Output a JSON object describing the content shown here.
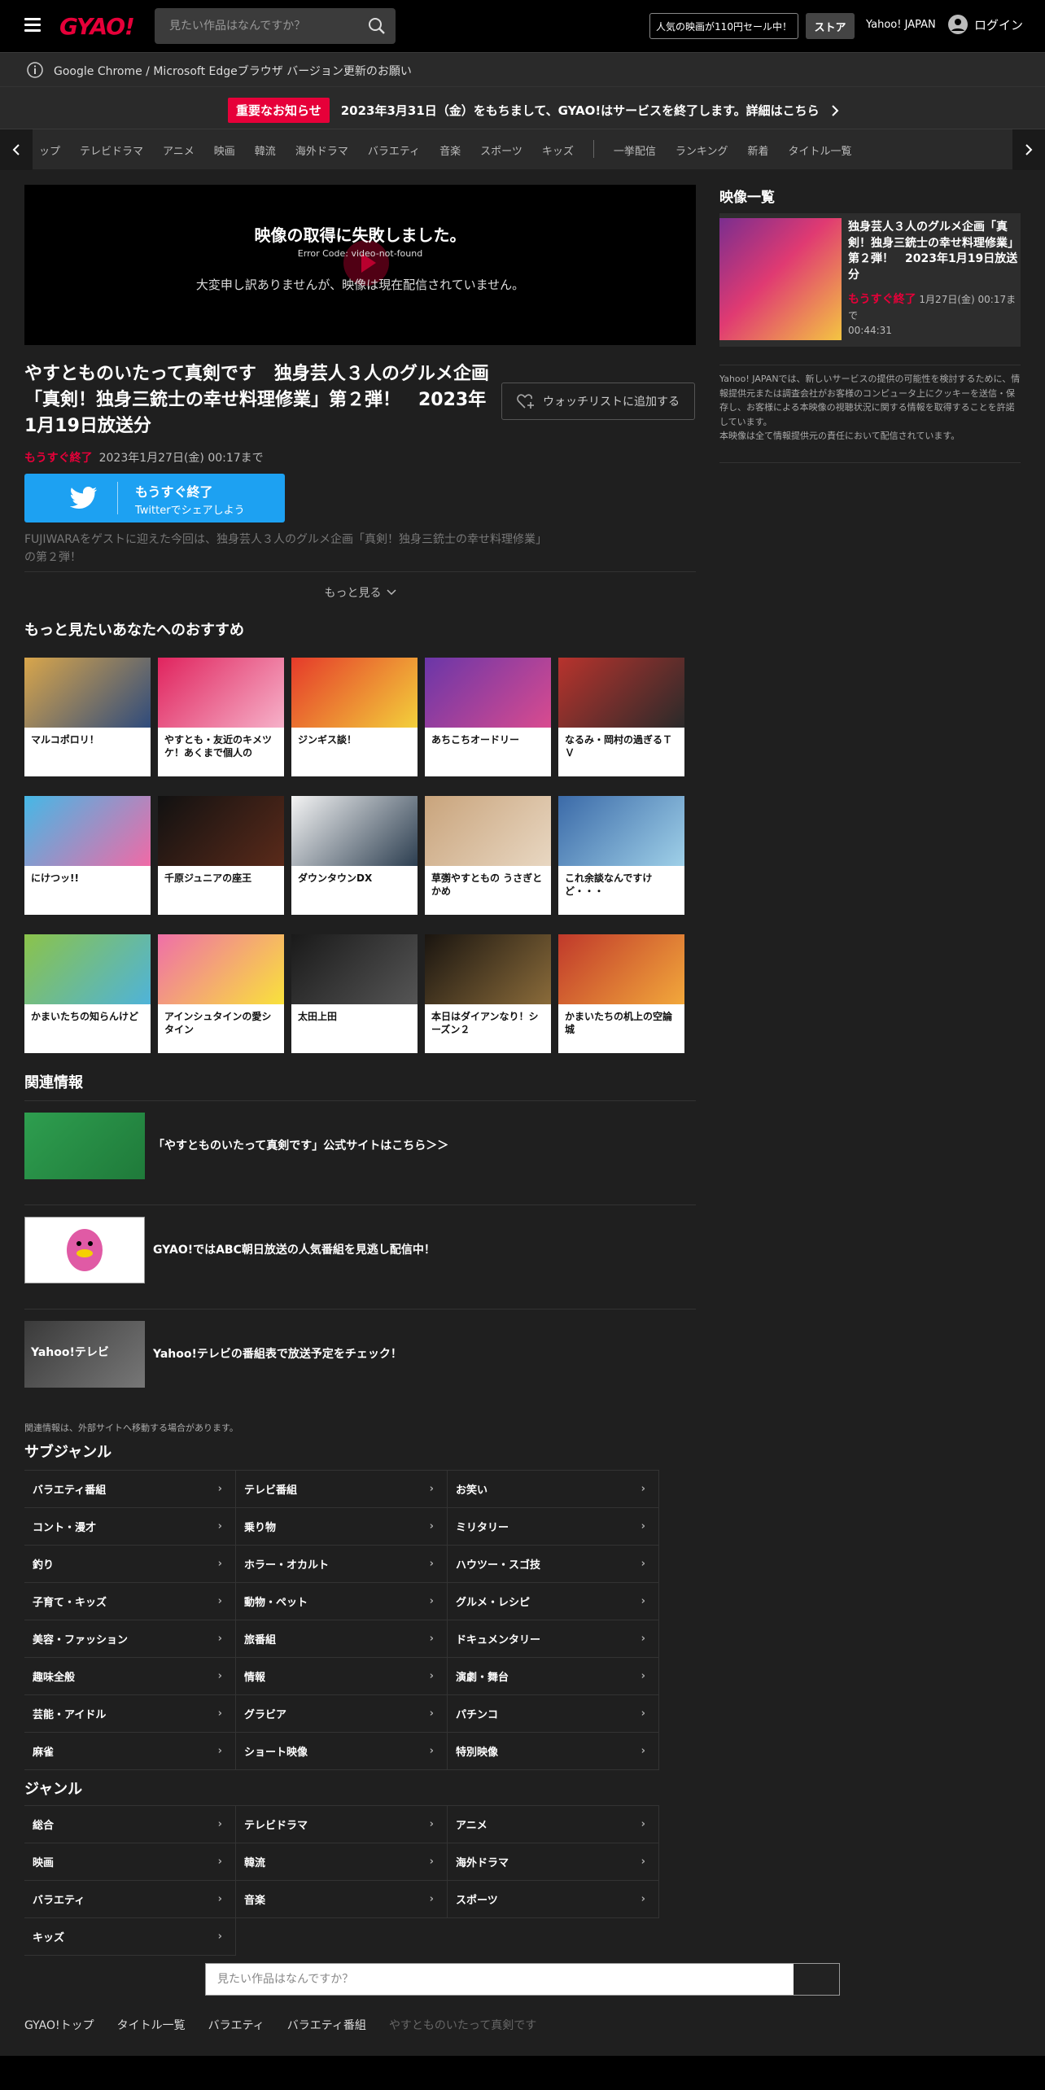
{
  "header": {
    "logo": "GYAO!",
    "search_placeholder": "見たい作品はなんですか？",
    "promo": "人気の映画が110円セール中！",
    "store": "ストア",
    "yahoo_japan": "Yahoo! JAPAN",
    "login": "ログイン"
  },
  "notice": {
    "browser": "Google Chrome / Microsoft Edgeブラウザ バージョン更新のお願い",
    "badge": "重要なお知らせ",
    "message": "2023年3月31日（金）をもちまして、GYAO!はサービスを終了します。詳細はこちら"
  },
  "nav": {
    "items": [
      "ップ",
      "テレビドラマ",
      "アニメ",
      "映画",
      "韓流",
      "海外ドラマ",
      "バラエティ",
      "音楽",
      "スポーツ",
      "キッズ"
    ],
    "items2": [
      "一挙配信",
      "ランキング",
      "新着",
      "タイトル一覧"
    ]
  },
  "player": {
    "error_title": "映像の取得に失敗しました。",
    "error_code": "Error Code: video-not-found",
    "error_msg": "大変申し訳ありませんが、映像は現在配信されていません。"
  },
  "video": {
    "title": "やすとものいたって真剣です　独身芸人３人のグルメ企画「真剣！独身三銃士の幸せ料理修業」第２弾！　2023年1月19日放送分",
    "watchlist": "ウォッチリストに追加する",
    "status": "もうすぐ終了",
    "until": "2023年1月27日(金) 00:17まで",
    "share_status": "もうすぐ終了",
    "share_label": "Twitterでシェアしよう",
    "description": "FUJIWARAをゲストに迎えた今回は、独身芸人３人のグルメ企画「真剣！独身三銃士の幸せ料理修業」の第２弾！",
    "more": "もっと見る"
  },
  "recommend": {
    "heading": "もっと見たいあなたへのおすすめ",
    "items": [
      {
        "label": "マルコポロリ！",
        "c1": "#d9a64b",
        "c2": "#2f4b7c"
      },
      {
        "label": "やすとも・友近のキメツケ！あくまで個人の",
        "c1": "#e0245e",
        "c2": "#f6b1c9"
      },
      {
        "label": "ジンギス談！",
        "c1": "#e53a2a",
        "c2": "#f3d03b"
      },
      {
        "label": "あちこちオードリー",
        "c1": "#6a36a8",
        "c2": "#d94b8f"
      },
      {
        "label": "なるみ・岡村の過ぎるＴＶ",
        "c1": "#b8332d",
        "c2": "#2a2a2a"
      },
      {
        "label": "にけつッ!!",
        "c1": "#45b8e6",
        "c2": "#f06aa6"
      },
      {
        "label": "千原ジュニアの座王",
        "c1": "#111111",
        "c2": "#5a2a1a"
      },
      {
        "label": "ダウンタウンDX",
        "c1": "#f4f4f4",
        "c2": "#2c3e50"
      },
      {
        "label": "草彅やすともの うさぎとかめ",
        "c1": "#c9a47c",
        "c2": "#e8d7c2"
      },
      {
        "label": "これ余談なんですけど・・・",
        "c1": "#3b6aa8",
        "c2": "#9fd0e8"
      },
      {
        "label": "かまいたちの知らんけど",
        "c1": "#8bc34a",
        "c2": "#4fb3d9"
      },
      {
        "label": "アインシュタインの愛シタイン",
        "c1": "#ef6fa8",
        "c2": "#f9e23b"
      },
      {
        "label": "太田上田",
        "c1": "#1a1a1a",
        "c2": "#555555"
      },
      {
        "label": "本日はダイアンなり！シーズン２",
        "c1": "#1a1510",
        "c2": "#8a6b3a"
      },
      {
        "label": "かまいたちの机上の空論城",
        "c1": "#c0392b",
        "c2": "#f2a83b"
      }
    ]
  },
  "related": {
    "heading": "関連情報",
    "items": [
      {
        "label": "「やすとものいたって真剣です」公式サイトはこちら＞＞",
        "c1": "#2e9e4f",
        "c2": "#1f7a3a"
      },
      {
        "label": "GYAO!ではABC朝日放送の人気番組を見逃し配信中！",
        "c1": "#ffffff",
        "c2": "#ffffff"
      },
      {
        "label": "Yahoo!テレビの番組表で放送予定をチェック！",
        "c1": "#3a3a3a",
        "c2": "#777777"
      }
    ],
    "note": "関連情報は、外部サイトへ移動する場合があります。",
    "img_text": "Yahoo!テレビ"
  },
  "subgenre": {
    "heading": "サブジャンル",
    "items": [
      "バラエティ番組",
      "テレビ番組",
      "お笑い",
      "コント・漫才",
      "乗り物",
      "ミリタリー",
      "釣り",
      "ホラー・オカルト",
      "ハウツー・スゴ技",
      "子育て・キッズ",
      "動物・ペット",
      "グルメ・レシピ",
      "美容・ファッション",
      "旅番組",
      "ドキュメンタリー",
      "趣味全般",
      "情報",
      "演劇・舞台",
      "芸能・アイドル",
      "グラビア",
      "パチンコ",
      "麻雀",
      "ショート映像",
      "特別映像"
    ]
  },
  "genre": {
    "heading": "ジャンル",
    "items": [
      "総合",
      "テレビドラマ",
      "アニメ",
      "映画",
      "韓流",
      "海外ドラマ",
      "バラエティ",
      "音楽",
      "スポーツ",
      "キッズ"
    ]
  },
  "footer": {
    "search_placeholder": "見たい作品はなんですか？",
    "crumbs": [
      "GYAO!トップ",
      "タイトル一覧",
      "バラエティ",
      "バラエティ番組"
    ],
    "current": "やすとものいたって真剣です"
  },
  "sidebar": {
    "heading": "映像一覧",
    "card_title": "独身芸人３人のグルメ企画「真剣！独身三銃士の幸せ料理修業」第２弾！　2023年1月19日放送分",
    "card_status": "もうすぐ終了",
    "card_until": "1月27日(金) 00:17まで",
    "card_duration": "00:44:31",
    "note": "Yahoo! JAPANでは、新しいサービスの提供の可能性を検討するために、情報提供元または調査会社がお客様のコンピュータ上にクッキーを送信・保存し、お客様による本映像の視聴状況に関する情報を取得することを許諾しています。\n本映像は全て情報提供元の責任において配信されています。"
  },
  "colors": {
    "brand": "#e60039",
    "twitter": "#1da1f2",
    "background": "#1f1f1f"
  }
}
